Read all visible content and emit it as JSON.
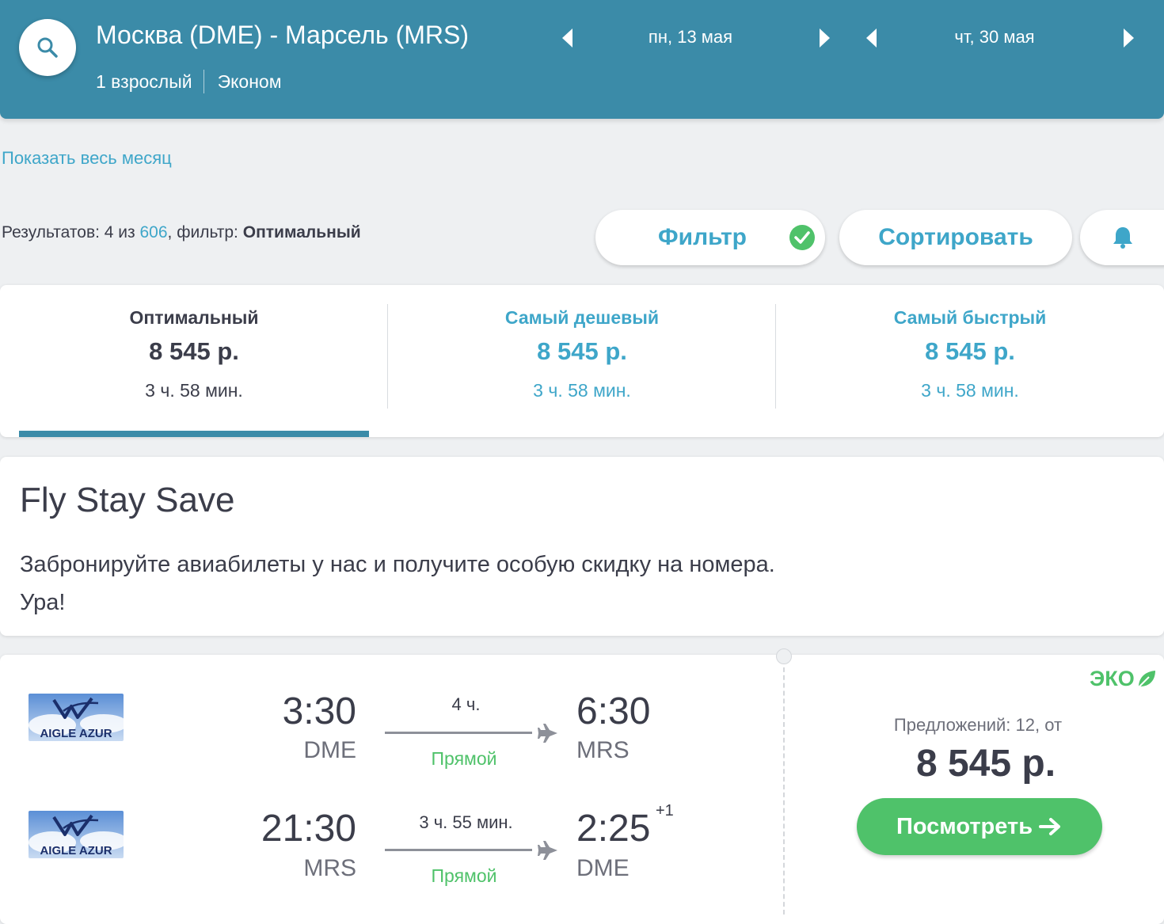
{
  "colors": {
    "header_bg": "#3b8ba8",
    "link": "#3ea6c9",
    "green": "#4fc26a",
    "text": "#3b3d4a"
  },
  "header": {
    "route": "Москва (DME) - Марсель (MRS)",
    "passengers": "1 взрослый",
    "cabin": "Эконом",
    "depart_date": "пн, 13 мая",
    "return_date": "чт, 30 мая",
    "search_icon": "search-icon"
  },
  "show_month_link": "Показать весь месяц",
  "results": {
    "prefix": "Результатов: 4 из ",
    "total": "606",
    "filter_label": ", фильтр: ",
    "filter_value": "Оптимальный"
  },
  "toolbar": {
    "filter_label": "Фильтр",
    "sort_label": "Сортировать",
    "filter_icon": "check-circle-icon",
    "alert_icon": "bell-icon"
  },
  "sort_tabs": [
    {
      "label": "Оптимальный",
      "price": "8 545 р.",
      "duration": "3 ч. 58 мин.",
      "active": true
    },
    {
      "label": "Самый дешевый",
      "price": "8 545 р.",
      "duration": "3 ч. 58 мин.",
      "active": false
    },
    {
      "label": "Самый быстрый",
      "price": "8 545 р.",
      "duration": "3 ч. 58 мин.",
      "active": false
    }
  ],
  "promo": {
    "title": "Fly Stay Save",
    "text": "Забронируйте авиабилеты у нас и получите особую скидку на номера. Ура!"
  },
  "result": {
    "eco_label": "ЭКО",
    "offers": "Предложений: 12, от",
    "price": "8 545 р.",
    "view_label": "Посмотреть",
    "legs": [
      {
        "airline": "AIGLE AZUR",
        "depart_time": "3:30",
        "depart_airport": "DME",
        "duration": "4 ч.",
        "stops": "Прямой",
        "arrive_time": "6:30",
        "arrive_airport": "MRS",
        "plus_day": ""
      },
      {
        "airline": "AIGLE AZUR",
        "depart_time": "21:30",
        "depart_airport": "MRS",
        "duration": "3 ч. 55 мин.",
        "stops": "Прямой",
        "arrive_time": "2:25",
        "arrive_airport": "DME",
        "plus_day": "+1"
      }
    ]
  }
}
